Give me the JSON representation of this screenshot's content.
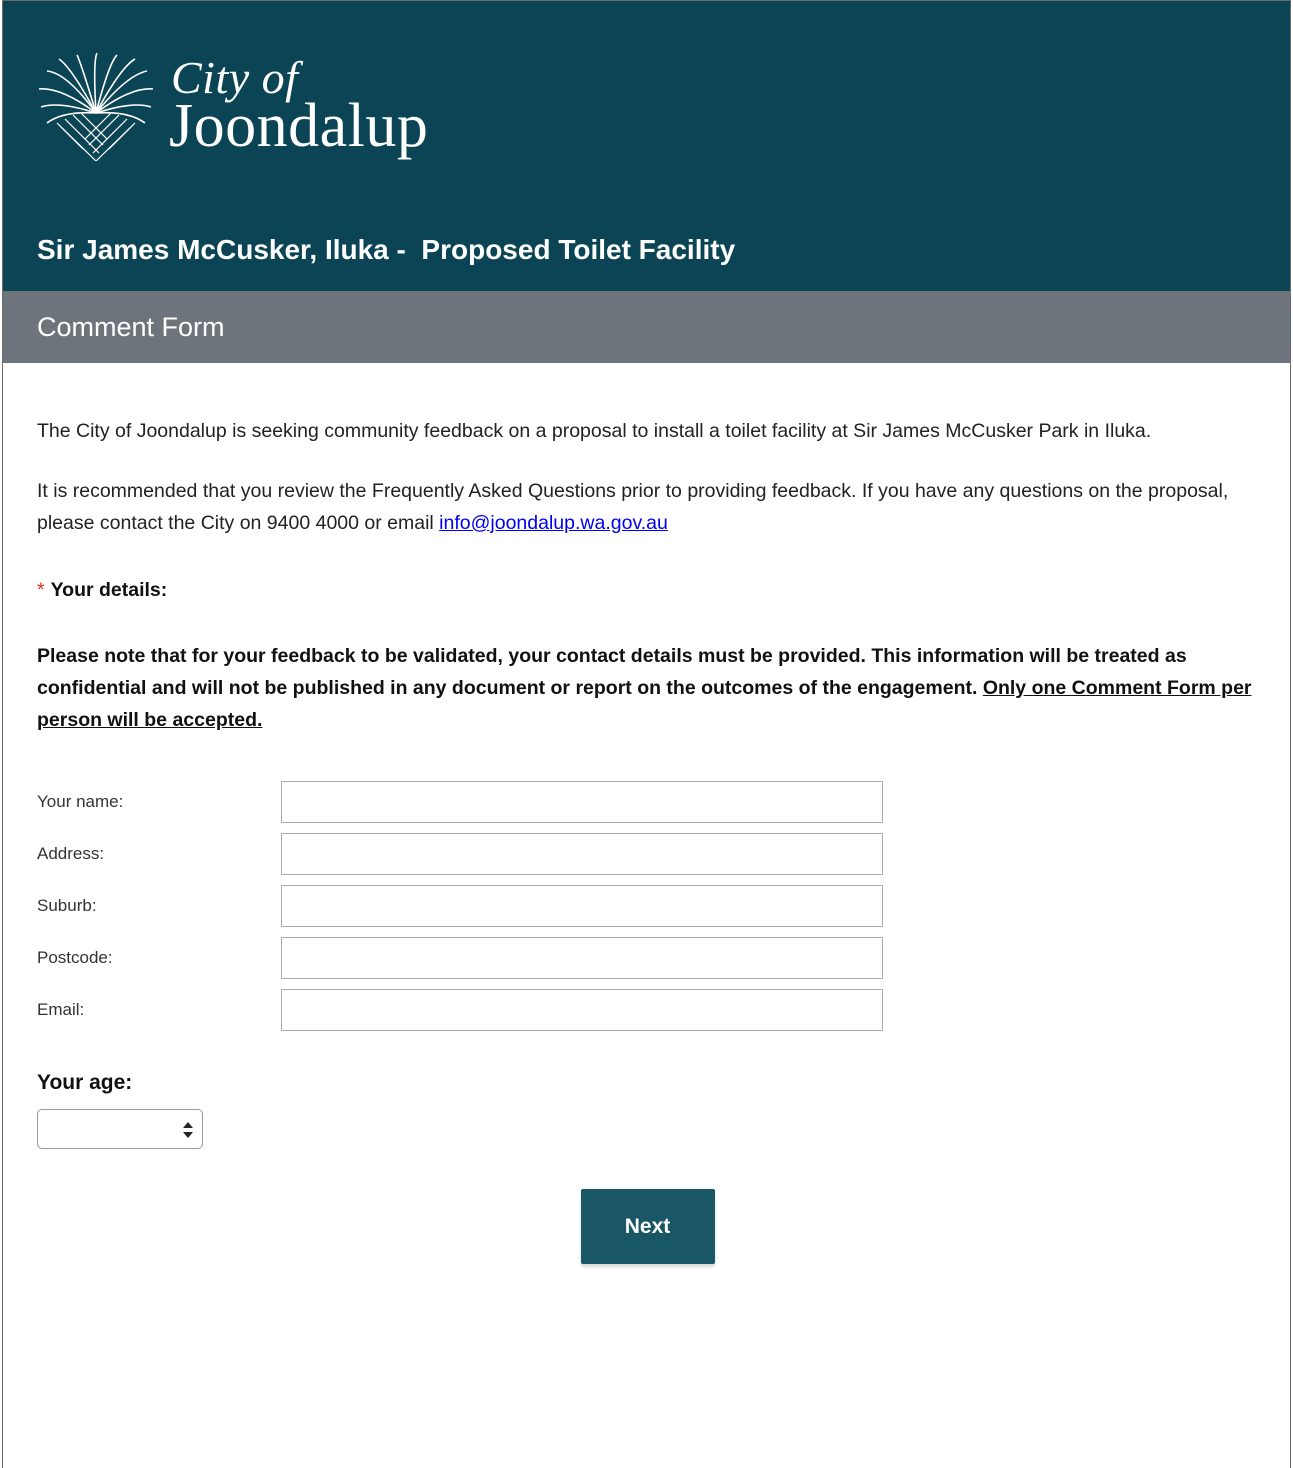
{
  "header": {
    "logo_line1": "City of",
    "logo_line2": "Joondalup",
    "page_title": "Sir James McCusker, Iluka -  Proposed Toilet Facility"
  },
  "subheader": {
    "title": "Comment Form"
  },
  "intro": {
    "paragraph1": "The City of Joondalup is seeking community feedback on a proposal to install a toilet facility at Sir James McCusker Park in Iluka.",
    "paragraph2_text": "It is recommended that you review the Frequently Asked Questions prior to providing feedback. If you have any questions on the proposal, please contact the City on 9400 4000 or email ",
    "email_link": "info@joondalup.wa.gov.au"
  },
  "details": {
    "required_marker": "*",
    "heading": "Your details:",
    "notice_text": "Please note that for your feedback to be validated, your contact details must be provided. This information will be treated as confidential and will not be published in any document or report on the outcomes of the engagement. ",
    "notice_underlined": "Only one Comment Form per person will be accepted."
  },
  "form": {
    "fields": [
      {
        "label": "Your name:",
        "value": ""
      },
      {
        "label": "Address:",
        "value": ""
      },
      {
        "label": "Suburb:",
        "value": ""
      },
      {
        "label": "Postcode:",
        "value": ""
      },
      {
        "label": "Email:",
        "value": ""
      }
    ],
    "age_label": "Your age:",
    "age_selected": ""
  },
  "actions": {
    "next_label": "Next"
  },
  "colors": {
    "header_bg": "#0b4555",
    "subheader_bg": "#6e747b",
    "button_bg": "#1a5766",
    "link": "#0000ee",
    "required": "#e0301e"
  },
  "icons": {
    "logo": "palm-fan-logo-icon",
    "select_arrows": "updown-arrows-icon"
  }
}
